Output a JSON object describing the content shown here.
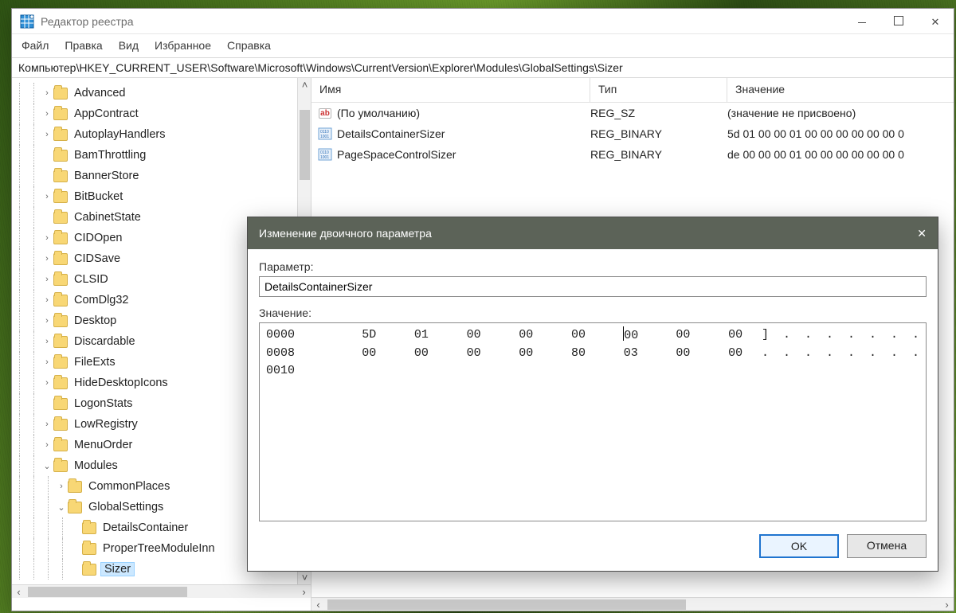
{
  "window": {
    "title": "Редактор реестра",
    "addressbar": "Компьютер\\HKEY_CURRENT_USER\\Software\\Microsoft\\Windows\\CurrentVersion\\Explorer\\Modules\\GlobalSettings\\Sizer"
  },
  "menubar": [
    "Файл",
    "Правка",
    "Вид",
    "Избранное",
    "Справка"
  ],
  "tree": [
    {
      "level": 2,
      "twist": ">",
      "label": "Advanced"
    },
    {
      "level": 2,
      "twist": ">",
      "label": "AppContract"
    },
    {
      "level": 2,
      "twist": ">",
      "label": "AutoplayHandlers"
    },
    {
      "level": 2,
      "twist": "",
      "label": "BamThrottling"
    },
    {
      "level": 2,
      "twist": "",
      "label": "BannerStore"
    },
    {
      "level": 2,
      "twist": ">",
      "label": "BitBucket"
    },
    {
      "level": 2,
      "twist": "",
      "label": "CabinetState"
    },
    {
      "level": 2,
      "twist": ">",
      "label": "CIDOpen"
    },
    {
      "level": 2,
      "twist": ">",
      "label": "CIDSave"
    },
    {
      "level": 2,
      "twist": ">",
      "label": "CLSID"
    },
    {
      "level": 2,
      "twist": ">",
      "label": "ComDlg32"
    },
    {
      "level": 2,
      "twist": ">",
      "label": "Desktop"
    },
    {
      "level": 2,
      "twist": ">",
      "label": "Discardable"
    },
    {
      "level": 2,
      "twist": ">",
      "label": "FileExts"
    },
    {
      "level": 2,
      "twist": ">",
      "label": "HideDesktopIcons"
    },
    {
      "level": 2,
      "twist": "",
      "label": "LogonStats"
    },
    {
      "level": 2,
      "twist": ">",
      "label": "LowRegistry"
    },
    {
      "level": 2,
      "twist": ">",
      "label": "MenuOrder"
    },
    {
      "level": 2,
      "twist": "v",
      "label": "Modules"
    },
    {
      "level": 3,
      "twist": ">",
      "label": "CommonPlaces"
    },
    {
      "level": 3,
      "twist": "v",
      "label": "GlobalSettings"
    },
    {
      "level": 4,
      "twist": "",
      "label": "DetailsContainer"
    },
    {
      "level": 4,
      "twist": "",
      "label": "ProperTreeModuleInn"
    },
    {
      "level": 4,
      "twist": "",
      "label": "Sizer",
      "selected": true
    }
  ],
  "values": {
    "columns": {
      "name": "Имя",
      "type": "Тип",
      "value": "Значение"
    },
    "rows": [
      {
        "icon": "ab",
        "name": "(По умолчанию)",
        "type": "REG_SZ",
        "value": "(значение не присвоено)"
      },
      {
        "icon": "bin",
        "name": "DetailsContainerSizer",
        "type": "REG_BINARY",
        "value": "5d 01 00 00 01 00 00 00 00 00 00 0"
      },
      {
        "icon": "bin",
        "name": "PageSpaceControlSizer",
        "type": "REG_BINARY",
        "value": "de 00 00 00 01 00 00 00 00 00 00 0"
      }
    ]
  },
  "dialog": {
    "title": "Изменение двоичного параметра",
    "param_label": "Параметр:",
    "param_value": "DetailsContainerSizer",
    "value_label": "Значение:",
    "hex": {
      "rows": [
        {
          "off": "0000",
          "bytes": [
            "5D",
            "01",
            "00",
            "00",
            "00",
            "00",
            "00",
            "00"
          ],
          "ascii": "]  .  .  .  .  .  .  ."
        },
        {
          "off": "0008",
          "bytes": [
            "00",
            "00",
            "00",
            "00",
            "80",
            "03",
            "00",
            "00"
          ],
          "ascii": ".  .  .  .  .  .  .  ."
        },
        {
          "off": "0010",
          "bytes": [
            "",
            "",
            "",
            "",
            "",
            "",
            "",
            ""
          ],
          "ascii": ""
        }
      ]
    },
    "ok": "OK",
    "cancel": "Отмена"
  }
}
